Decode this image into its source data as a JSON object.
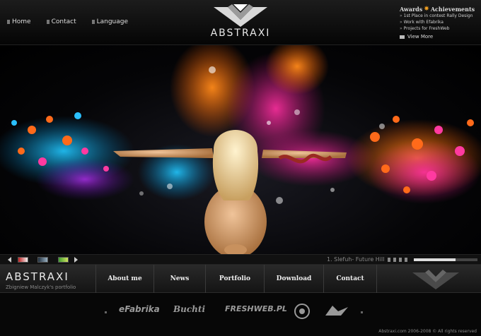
{
  "header": {
    "nav": [
      "Home",
      "Contact",
      "Language"
    ],
    "logo_text": "ABSTRAXI"
  },
  "awards": {
    "title_part1": "Awards",
    "title_part2": "Achievements",
    "items": [
      "1st Place in contest Rally Design",
      "Work with Efabrika",
      "Projects for FreshWeb"
    ],
    "view_more": "View More"
  },
  "slider": {
    "caption": "1. Slefuh- Future Hill",
    "progress": 0.65
  },
  "mainnav": {
    "brand": "ABSTRAXI",
    "subtitle": "Zbigniew Malczyk's portfolio",
    "items": [
      "About me",
      "News",
      "Portfolio",
      "Download",
      "Contact"
    ]
  },
  "partners": [
    "eFabrika",
    "Buchti",
    "FRESHWEB.PL"
  ],
  "footer": {
    "copyright": "Abstraxi.com 2006-2008 © All rights reserved"
  },
  "colors": {
    "accent_orange": "#f3a021",
    "accent_pink": "#e0307a",
    "accent_cyan": "#28b8e8"
  }
}
